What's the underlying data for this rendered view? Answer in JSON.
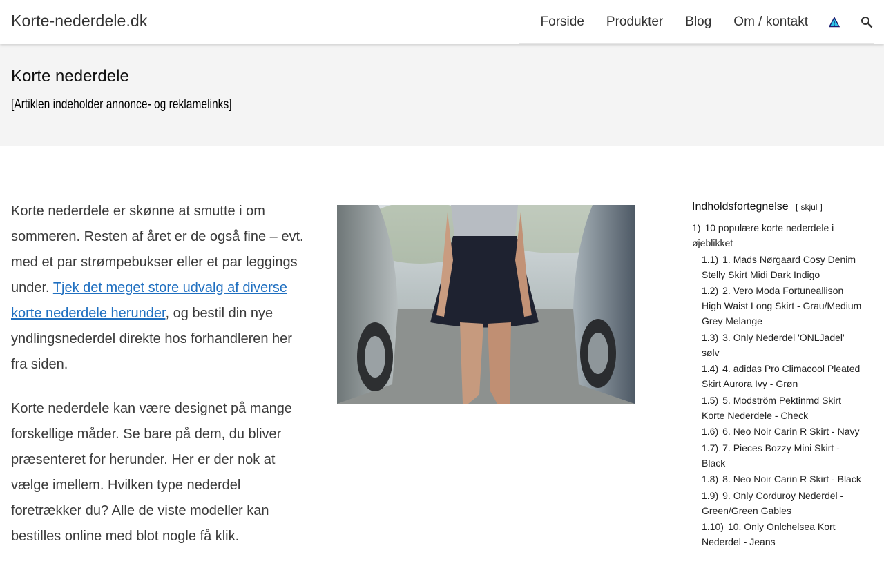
{
  "header": {
    "site_title": "Korte-nederdele.dk",
    "nav": [
      "Forside",
      "Produkter",
      "Blog",
      "Om / kontakt"
    ],
    "icons": {
      "warning": "warning-icon",
      "search": "search-icon"
    },
    "accent_color": "#1f6fc0"
  },
  "title_band": {
    "title": "Korte nederdele",
    "disclaimer": "[Artiklen indeholder annonce- og reklamelinks]"
  },
  "content": {
    "p1_text_before": "Korte nederdele er skønne at smutte i om sommeren. Resten af året er de også fine – evt. med et par strømpebukser eller et par leggings under. ",
    "p1_link": "Tjek det meget store udvalg af diverse korte nederdele herunder",
    "p1_text_after": ", og bestil din nye yndlingsnederdel direkte hos forhandleren her fra siden.",
    "p2": "Korte nederdele kan være designet på mange forskellige måder. Se bare på dem, du bliver præsenteret for herunder. Her er der nok at vælge imellem. Hvilken type nederdel foretrækker du? Alle de viste modeller kan bestilles online med blot nogle få klik."
  },
  "toc": {
    "title": "Indholdsfortegnelse",
    "toggle_label": "skjul",
    "items": [
      {
        "num": "1)",
        "label": "10 populære korte nederdele i øjeblikket"
      },
      {
        "num": "1.1)",
        "label": "1. Mads Nørgaard Cosy Denim Stelly Skirt Midi Dark Indigo"
      },
      {
        "num": "1.2)",
        "label": "2. Vero Moda Fortuneallison High Waist Long Skirt - Grau/Medium Grey Melange"
      },
      {
        "num": "1.3)",
        "label": "3. Only Nederdel 'ONLJadel' sølv"
      },
      {
        "num": "1.4)",
        "label": "4. adidas Pro Climacool Pleated Skirt Aurora Ivy - Grøn"
      },
      {
        "num": "1.5)",
        "label": "5. Modström Pektinmd Skirt Korte Nederdele - Check"
      },
      {
        "num": "1.6)",
        "label": "6. Neo Noir Carin R Skirt - Navy"
      },
      {
        "num": "1.7)",
        "label": "7. Pieces Bozzy Mini Skirt - Black"
      },
      {
        "num": "1.8)",
        "label": "8. Neo Noir Carin R Skirt - Black"
      },
      {
        "num": "1.9)",
        "label": "9. Only Corduroy Nederdel - Green/Green Gables"
      },
      {
        "num": "1.10)",
        "label": "10. Only Onlchelsea Kort Nederdel - Jeans"
      }
    ]
  }
}
